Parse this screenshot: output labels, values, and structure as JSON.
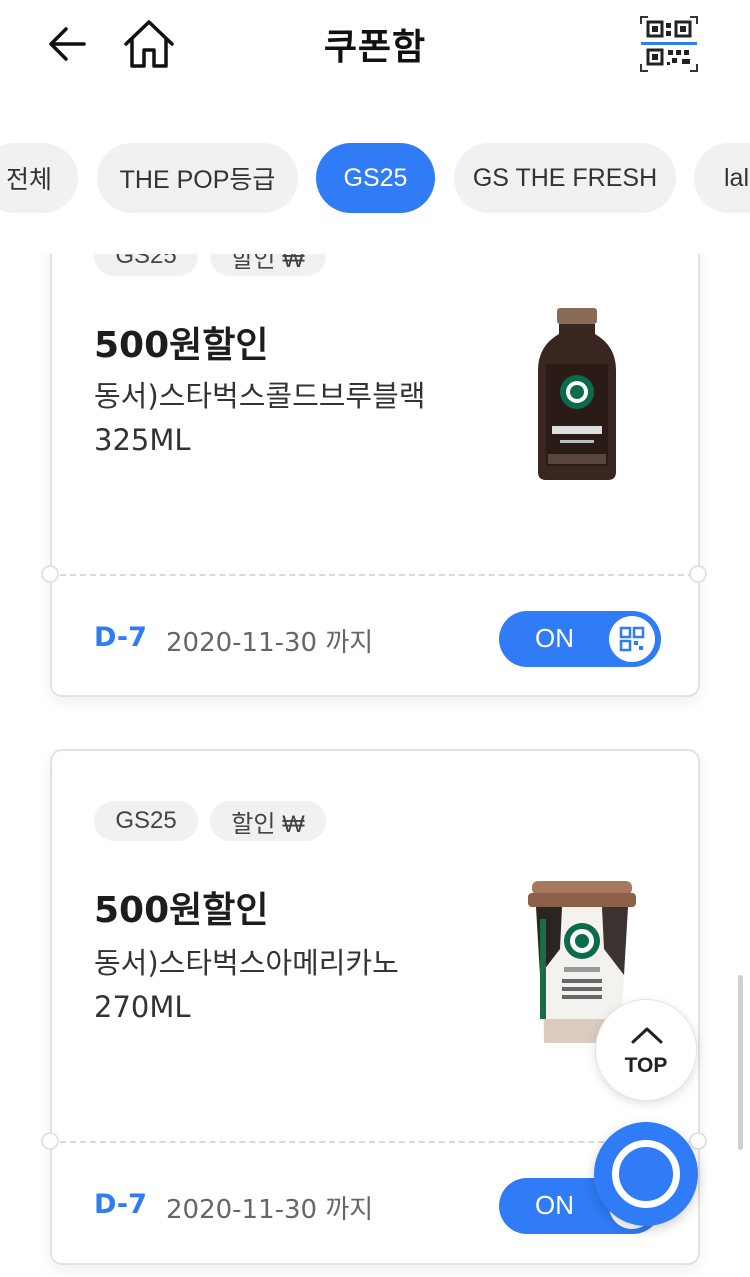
{
  "header": {
    "title": "쿠폰함",
    "back_icon": "arrow-left-icon",
    "home_icon": "home-icon",
    "qr_icon": "qr-code-icon"
  },
  "tabs": [
    {
      "label": "전체",
      "active": false
    },
    {
      "label": "THE POP등급",
      "active": false
    },
    {
      "label": "GS25",
      "active": true
    },
    {
      "label": "GS THE FRESH",
      "active": false
    },
    {
      "label": "lal",
      "active": false
    }
  ],
  "coupons": [
    {
      "tags": [
        "GS25",
        "할인 ₩"
      ],
      "title": "500원할인",
      "desc_line1": "동서)스타벅스콜드브루블랙",
      "desc_line2": "325ML",
      "dday": "D-7",
      "expire": "2020-11-30 까지",
      "toggle": "ON",
      "product": "starbucks-cold-brew-bottle"
    },
    {
      "tags": [
        "GS25",
        "할인 ₩"
      ],
      "title": "500원할인",
      "desc_line1": "동서)스타벅스아메리카노",
      "desc_line2": "270ML",
      "dday": "D-7",
      "expire": "2020-11-30 까지",
      "toggle": "ON",
      "product": "starbucks-americano-cup"
    }
  ],
  "floating": {
    "top_label": "TOP",
    "fab_icon": "circle-icon"
  },
  "colors": {
    "accent": "#2f7cf6",
    "chip_bg": "#f1f1f3",
    "border": "#e2e2e2"
  }
}
